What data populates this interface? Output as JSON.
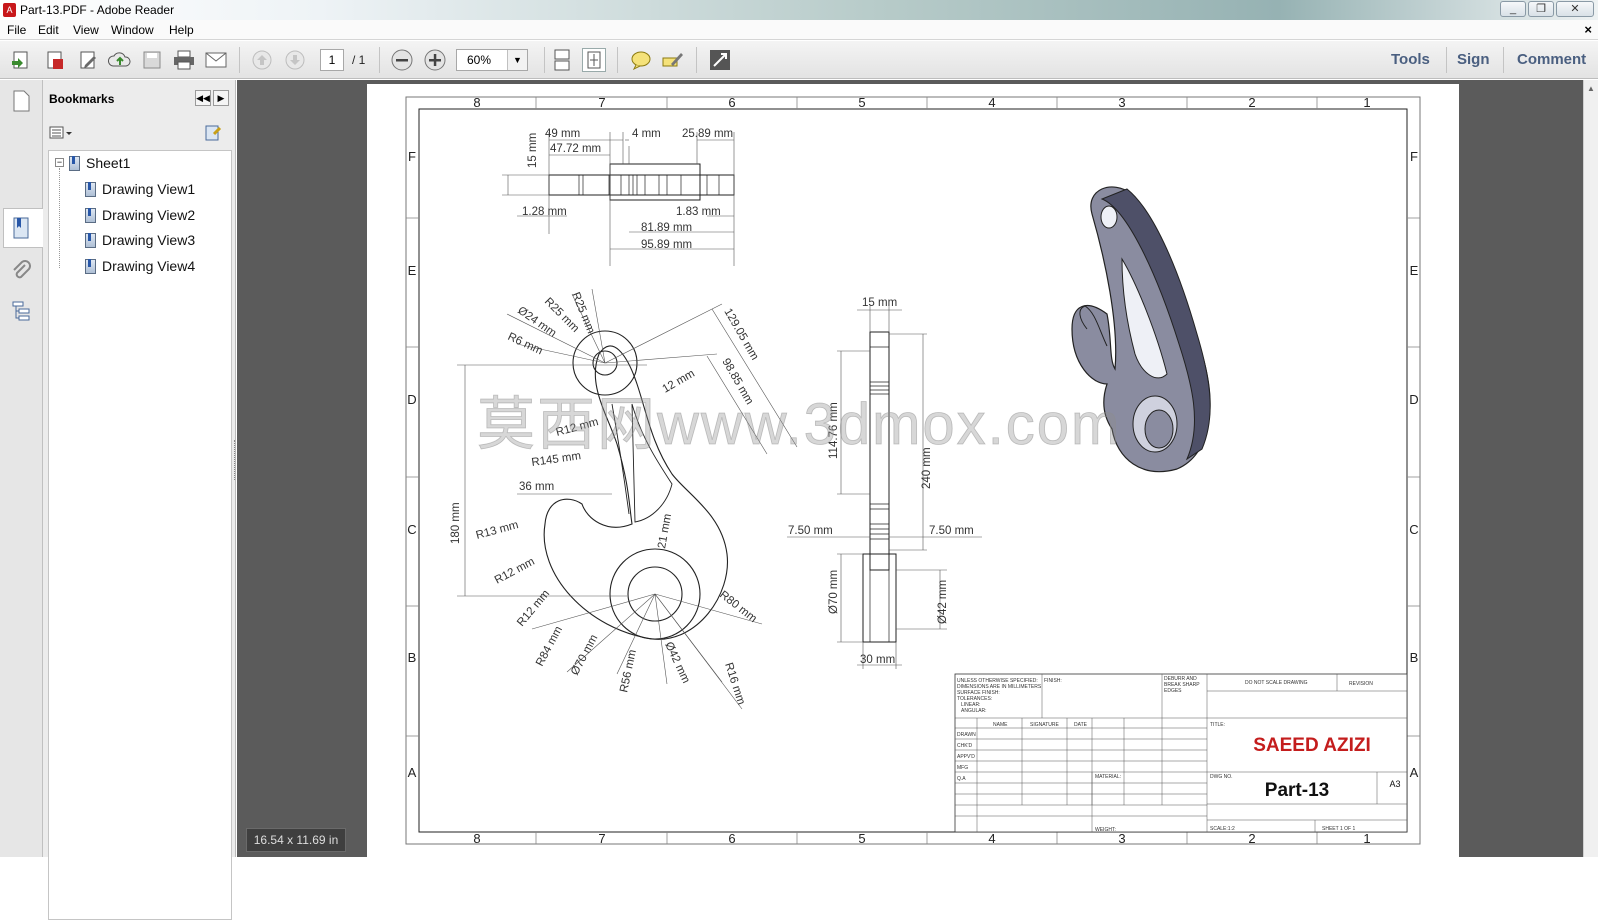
{
  "window": {
    "title": "Part-13.PDF - Adobe Reader",
    "app_icon": "adobe-reader-icon",
    "controls": [
      "minimize-icon",
      "restore-icon",
      "close-icon"
    ]
  },
  "menu": {
    "items": [
      "File",
      "Edit",
      "View",
      "Window",
      "Help"
    ],
    "close_doc": "×"
  },
  "toolbar": {
    "page_current": "1",
    "page_total": "/ 1",
    "zoom": "60%",
    "tools_label": "Tools",
    "sign_label": "Sign",
    "comment_label": "Comment"
  },
  "bookmarks": {
    "title": "Bookmarks",
    "items": [
      "Sheet1",
      "Drawing View1",
      "Drawing View2",
      "Drawing View3",
      "Drawing View4"
    ]
  },
  "status": {
    "page_size": "16.54 x 11.69 in"
  },
  "drawing": {
    "col_labels": [
      "8",
      "7",
      "6",
      "5",
      "4",
      "3",
      "2",
      "1"
    ],
    "row_labels": [
      "F",
      "E",
      "D",
      "C",
      "B",
      "A"
    ],
    "watermark": "莫西网www.3dmox.com",
    "dims_top": {
      "d49": "49 mm",
      "d4": "4 mm",
      "d2589": "25.89 mm",
      "d4772": "47.72 mm",
      "d15": "15 mm",
      "d128": "1.28 mm",
      "d183": "1.83 mm",
      "d8189": "81.89 mm",
      "d9589": "95.89 mm"
    },
    "dims_front": {
      "r25a": "R25 mm",
      "r25b": "R25 mm",
      "d24": "Ø24 mm",
      "r6": "R6 mm",
      "d12905": "129.05 mm",
      "d9885": "98.85 mm",
      "d12": "12 mm",
      "r145": "R145 mm",
      "d36": "36 mm",
      "d180": "180 mm",
      "r13": "R13 mm",
      "r12a": "R12 mm",
      "r12b": "R12 mm",
      "r84": "R84 mm",
      "d70": "Ø70 mm",
      "r56": "R56 mm",
      "d42": "Ø42 mm",
      "r16": "R16 mm",
      "r80": "R80 mm",
      "d21": "21 mm",
      "r12c": "R12 mm"
    },
    "dims_side": {
      "d15": "15 mm",
      "d11476": "114.76 mm",
      "d240": "240 mm",
      "d750a": "7.50 mm",
      "d750b": "7.50 mm",
      "d70": "Ø70 mm",
      "d42": "Ø42 mm",
      "d30": "30 mm"
    },
    "title_block": {
      "unless": "UNLESS OTHERWISE SPECIFIED:",
      "dims_in": "DIMENSIONS ARE IN MILLIMETERS",
      "surface": "SURFACE FINISH:",
      "tolerances": "TOLERANCES:",
      "linear": "LINEAR:",
      "angular": "ANGULAR:",
      "finish": "FINISH:",
      "deburr": "DEBURR AND",
      "break": "BREAK SHARP",
      "edges": "EDGES",
      "do_not_scale": "DO NOT SCALE DRAWING",
      "revision": "REVISION",
      "name": "NAME",
      "signature": "SIGNATURE",
      "date": "DATE",
      "title_lbl": "TITLE:",
      "drawn": "DRAWN",
      "chkd": "CHK'D",
      "appvd": "APPV'D",
      "mfg": "MFG",
      "qa": "Q.A",
      "material": "MATERIAL:",
      "dwg_no": "DWG NO.",
      "weight": "WEIGHT:",
      "scale": "SCALE:1:2",
      "sheet": "SHEET 1 OF 1",
      "author": "SAEED AZIZI",
      "part": "Part-13",
      "size": "A3"
    }
  }
}
